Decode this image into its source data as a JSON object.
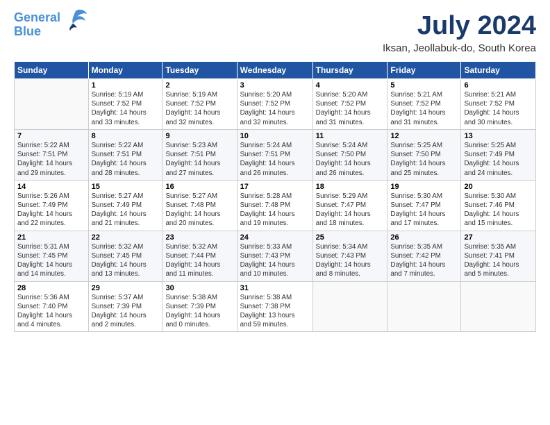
{
  "header": {
    "logo_line1": "General",
    "logo_line2": "Blue",
    "month": "July 2024",
    "location": "Iksan, Jeollabuk-do, South Korea"
  },
  "days_of_week": [
    "Sunday",
    "Monday",
    "Tuesday",
    "Wednesday",
    "Thursday",
    "Friday",
    "Saturday"
  ],
  "weeks": [
    [
      {
        "day": "",
        "info": ""
      },
      {
        "day": "1",
        "info": "Sunrise: 5:19 AM\nSunset: 7:52 PM\nDaylight: 14 hours\nand 33 minutes."
      },
      {
        "day": "2",
        "info": "Sunrise: 5:19 AM\nSunset: 7:52 PM\nDaylight: 14 hours\nand 32 minutes."
      },
      {
        "day": "3",
        "info": "Sunrise: 5:20 AM\nSunset: 7:52 PM\nDaylight: 14 hours\nand 32 minutes."
      },
      {
        "day": "4",
        "info": "Sunrise: 5:20 AM\nSunset: 7:52 PM\nDaylight: 14 hours\nand 31 minutes."
      },
      {
        "day": "5",
        "info": "Sunrise: 5:21 AM\nSunset: 7:52 PM\nDaylight: 14 hours\nand 31 minutes."
      },
      {
        "day": "6",
        "info": "Sunrise: 5:21 AM\nSunset: 7:52 PM\nDaylight: 14 hours\nand 30 minutes."
      }
    ],
    [
      {
        "day": "7",
        "info": "Sunrise: 5:22 AM\nSunset: 7:51 PM\nDaylight: 14 hours\nand 29 minutes."
      },
      {
        "day": "8",
        "info": "Sunrise: 5:22 AM\nSunset: 7:51 PM\nDaylight: 14 hours\nand 28 minutes."
      },
      {
        "day": "9",
        "info": "Sunrise: 5:23 AM\nSunset: 7:51 PM\nDaylight: 14 hours\nand 27 minutes."
      },
      {
        "day": "10",
        "info": "Sunrise: 5:24 AM\nSunset: 7:51 PM\nDaylight: 14 hours\nand 26 minutes."
      },
      {
        "day": "11",
        "info": "Sunrise: 5:24 AM\nSunset: 7:50 PM\nDaylight: 14 hours\nand 26 minutes."
      },
      {
        "day": "12",
        "info": "Sunrise: 5:25 AM\nSunset: 7:50 PM\nDaylight: 14 hours\nand 25 minutes."
      },
      {
        "day": "13",
        "info": "Sunrise: 5:25 AM\nSunset: 7:49 PM\nDaylight: 14 hours\nand 24 minutes."
      }
    ],
    [
      {
        "day": "14",
        "info": "Sunrise: 5:26 AM\nSunset: 7:49 PM\nDaylight: 14 hours\nand 22 minutes."
      },
      {
        "day": "15",
        "info": "Sunrise: 5:27 AM\nSunset: 7:49 PM\nDaylight: 14 hours\nand 21 minutes."
      },
      {
        "day": "16",
        "info": "Sunrise: 5:27 AM\nSunset: 7:48 PM\nDaylight: 14 hours\nand 20 minutes."
      },
      {
        "day": "17",
        "info": "Sunrise: 5:28 AM\nSunset: 7:48 PM\nDaylight: 14 hours\nand 19 minutes."
      },
      {
        "day": "18",
        "info": "Sunrise: 5:29 AM\nSunset: 7:47 PM\nDaylight: 14 hours\nand 18 minutes."
      },
      {
        "day": "19",
        "info": "Sunrise: 5:30 AM\nSunset: 7:47 PM\nDaylight: 14 hours\nand 17 minutes."
      },
      {
        "day": "20",
        "info": "Sunrise: 5:30 AM\nSunset: 7:46 PM\nDaylight: 14 hours\nand 15 minutes."
      }
    ],
    [
      {
        "day": "21",
        "info": "Sunrise: 5:31 AM\nSunset: 7:45 PM\nDaylight: 14 hours\nand 14 minutes."
      },
      {
        "day": "22",
        "info": "Sunrise: 5:32 AM\nSunset: 7:45 PM\nDaylight: 14 hours\nand 13 minutes."
      },
      {
        "day": "23",
        "info": "Sunrise: 5:32 AM\nSunset: 7:44 PM\nDaylight: 14 hours\nand 11 minutes."
      },
      {
        "day": "24",
        "info": "Sunrise: 5:33 AM\nSunset: 7:43 PM\nDaylight: 14 hours\nand 10 minutes."
      },
      {
        "day": "25",
        "info": "Sunrise: 5:34 AM\nSunset: 7:43 PM\nDaylight: 14 hours\nand 8 minutes."
      },
      {
        "day": "26",
        "info": "Sunrise: 5:35 AM\nSunset: 7:42 PM\nDaylight: 14 hours\nand 7 minutes."
      },
      {
        "day": "27",
        "info": "Sunrise: 5:35 AM\nSunset: 7:41 PM\nDaylight: 14 hours\nand 5 minutes."
      }
    ],
    [
      {
        "day": "28",
        "info": "Sunrise: 5:36 AM\nSunset: 7:40 PM\nDaylight: 14 hours\nand 4 minutes."
      },
      {
        "day": "29",
        "info": "Sunrise: 5:37 AM\nSunset: 7:39 PM\nDaylight: 14 hours\nand 2 minutes."
      },
      {
        "day": "30",
        "info": "Sunrise: 5:38 AM\nSunset: 7:39 PM\nDaylight: 14 hours\nand 0 minutes."
      },
      {
        "day": "31",
        "info": "Sunrise: 5:38 AM\nSunset: 7:38 PM\nDaylight: 13 hours\nand 59 minutes."
      },
      {
        "day": "",
        "info": ""
      },
      {
        "day": "",
        "info": ""
      },
      {
        "day": "",
        "info": ""
      }
    ]
  ]
}
